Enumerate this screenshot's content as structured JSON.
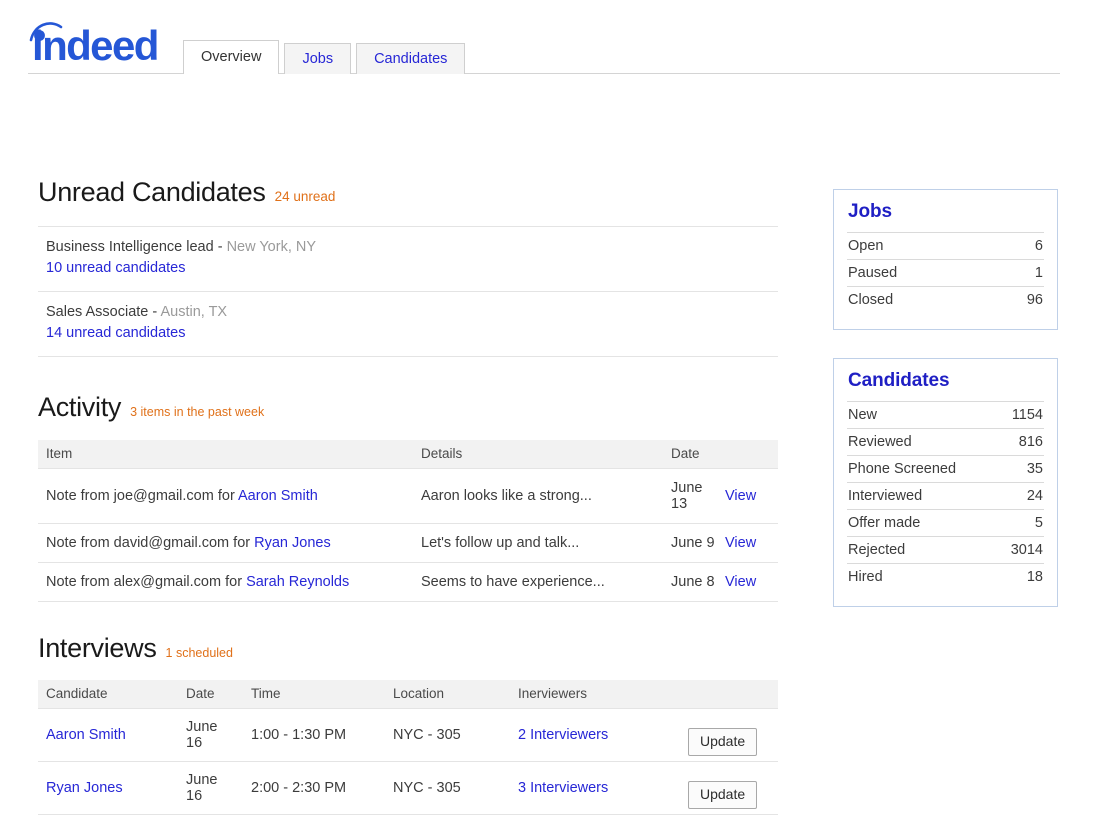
{
  "brand": {
    "logo_text": "indeed",
    "logo_color": "#2557d6",
    "accent_orange": "#e0711a",
    "link_blue": "#2727d6",
    "card_border": "#bfd0e8"
  },
  "tabs": [
    {
      "label": "Overview",
      "active": true
    },
    {
      "label": "Jobs",
      "active": false
    },
    {
      "label": "Candidates",
      "active": false
    }
  ],
  "unread": {
    "title": "Unread Candidates",
    "subtitle": "24 unread",
    "items": [
      {
        "job": "Business Intelligence lead",
        "separator": " - ",
        "location": "New York, NY",
        "link": "10 unread candidates"
      },
      {
        "job": "Sales Associate",
        "separator": " - ",
        "location": "Austin, TX",
        "link": "14 unread candidates"
      }
    ]
  },
  "activity": {
    "title": "Activity",
    "subtitle": "3 items in the past week",
    "columns": [
      "Item",
      "Details",
      "Date",
      ""
    ],
    "rows": [
      {
        "item_prefix": "Note from joe@gmail.com for ",
        "item_link": "Aaron Smith",
        "details": "Aaron looks like a strong...",
        "date": "June 13",
        "action": "View"
      },
      {
        "item_prefix": "Note from david@gmail.com for ",
        "item_link": "Ryan Jones",
        "details": "Let's follow up and talk...",
        "date": "June 9",
        "action": "View"
      },
      {
        "item_prefix": "Note from alex@gmail.com for ",
        "item_link": "Sarah Reynolds",
        "details": "Seems to have experience...",
        "date": "June 8",
        "action": "View"
      }
    ]
  },
  "interviews": {
    "title": "Interviews",
    "subtitle": "1 scheduled",
    "columns": [
      "Candidate",
      "Date",
      "Time",
      "Location",
      "Inerviewers",
      ""
    ],
    "rows": [
      {
        "candidate": "Aaron Smith",
        "date": "June 16",
        "time": "1:00 - 1:30 PM",
        "location": "NYC - 305",
        "interviewers": "2 Interviewers",
        "action": "Update"
      },
      {
        "candidate": "Ryan Jones",
        "date": "June 16",
        "time": "2:00 - 2:30 PM",
        "location": "NYC - 305",
        "interviewers": "3 Interviewers",
        "action": "Update"
      }
    ]
  },
  "sidebar": {
    "jobs_card": {
      "title": "Jobs",
      "stats": [
        {
          "label": "Open",
          "value": "6"
        },
        {
          "label": "Paused",
          "value": "1"
        },
        {
          "label": "Closed",
          "value": "96"
        }
      ]
    },
    "candidates_card": {
      "title": "Candidates",
      "stats": [
        {
          "label": "New",
          "value": "1154"
        },
        {
          "label": "Reviewed",
          "value": "816"
        },
        {
          "label": "Phone Screened",
          "value": "35"
        },
        {
          "label": "Interviewed",
          "value": "24"
        },
        {
          "label": "Offer made",
          "value": "5"
        },
        {
          "label": "Rejected",
          "value": "3014"
        },
        {
          "label": "Hired",
          "value": "18"
        }
      ]
    }
  }
}
